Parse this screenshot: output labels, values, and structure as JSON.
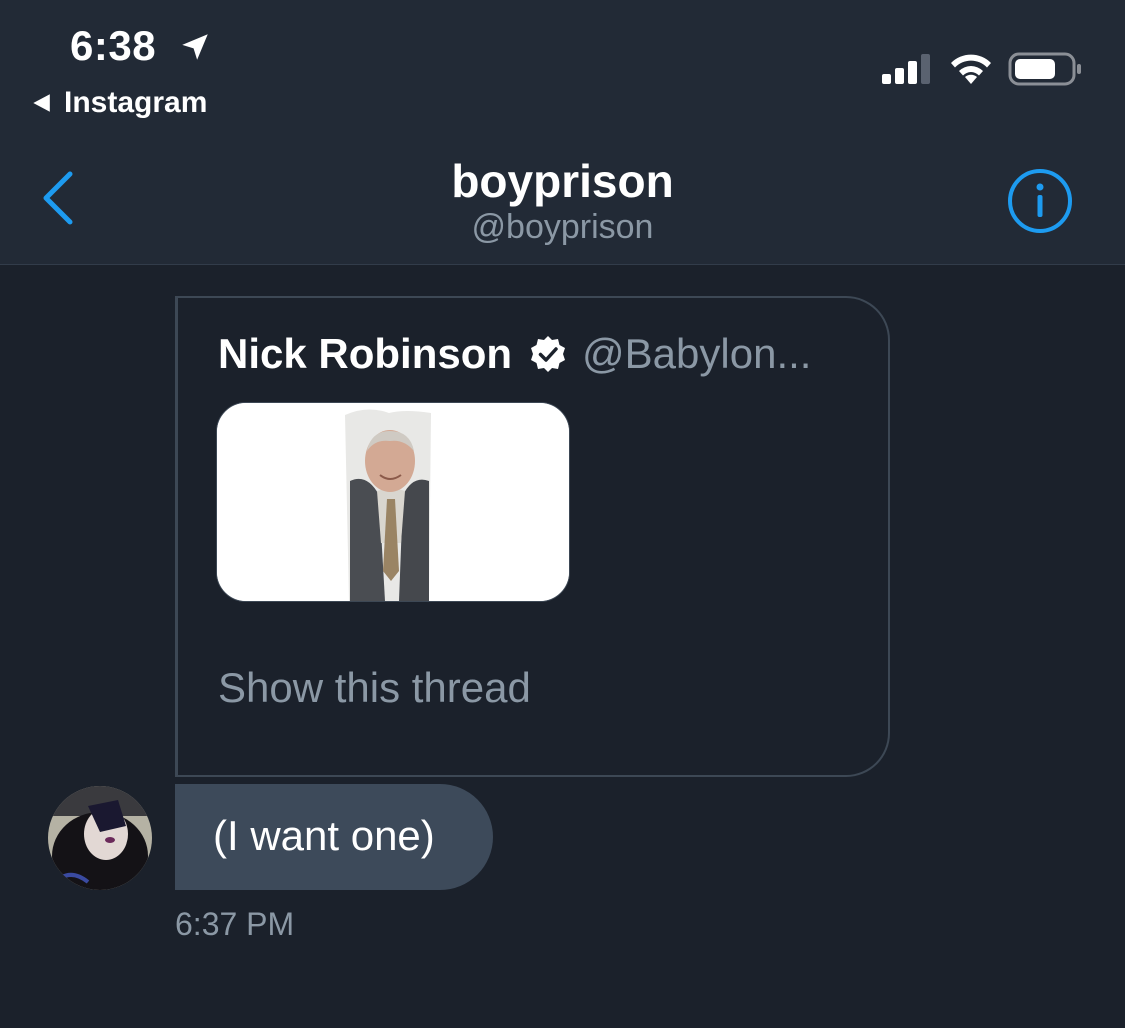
{
  "status_bar": {
    "time": "6:38",
    "back_app": "Instagram"
  },
  "nav": {
    "title": "boyprison",
    "handle": "@boyprison"
  },
  "tweet": {
    "author_name": "Nick Robinson",
    "author_handle": "@Babylon...",
    "show_thread": "Show this thread"
  },
  "message": {
    "text": "(I want one)",
    "timestamp": "6:37 PM"
  },
  "colors": {
    "accent": "#1d9bf0",
    "background": "#1b212b",
    "header": "#222a36",
    "bubble": "#3d4a5a",
    "secondary_text": "#8b98a5"
  },
  "icons": {
    "back": "chevron-left-icon",
    "info": "info-icon",
    "verified": "verified-badge-icon",
    "location": "location-arrow-icon",
    "signal": "cellular-signal-icon",
    "wifi": "wifi-icon",
    "battery": "battery-icon"
  }
}
